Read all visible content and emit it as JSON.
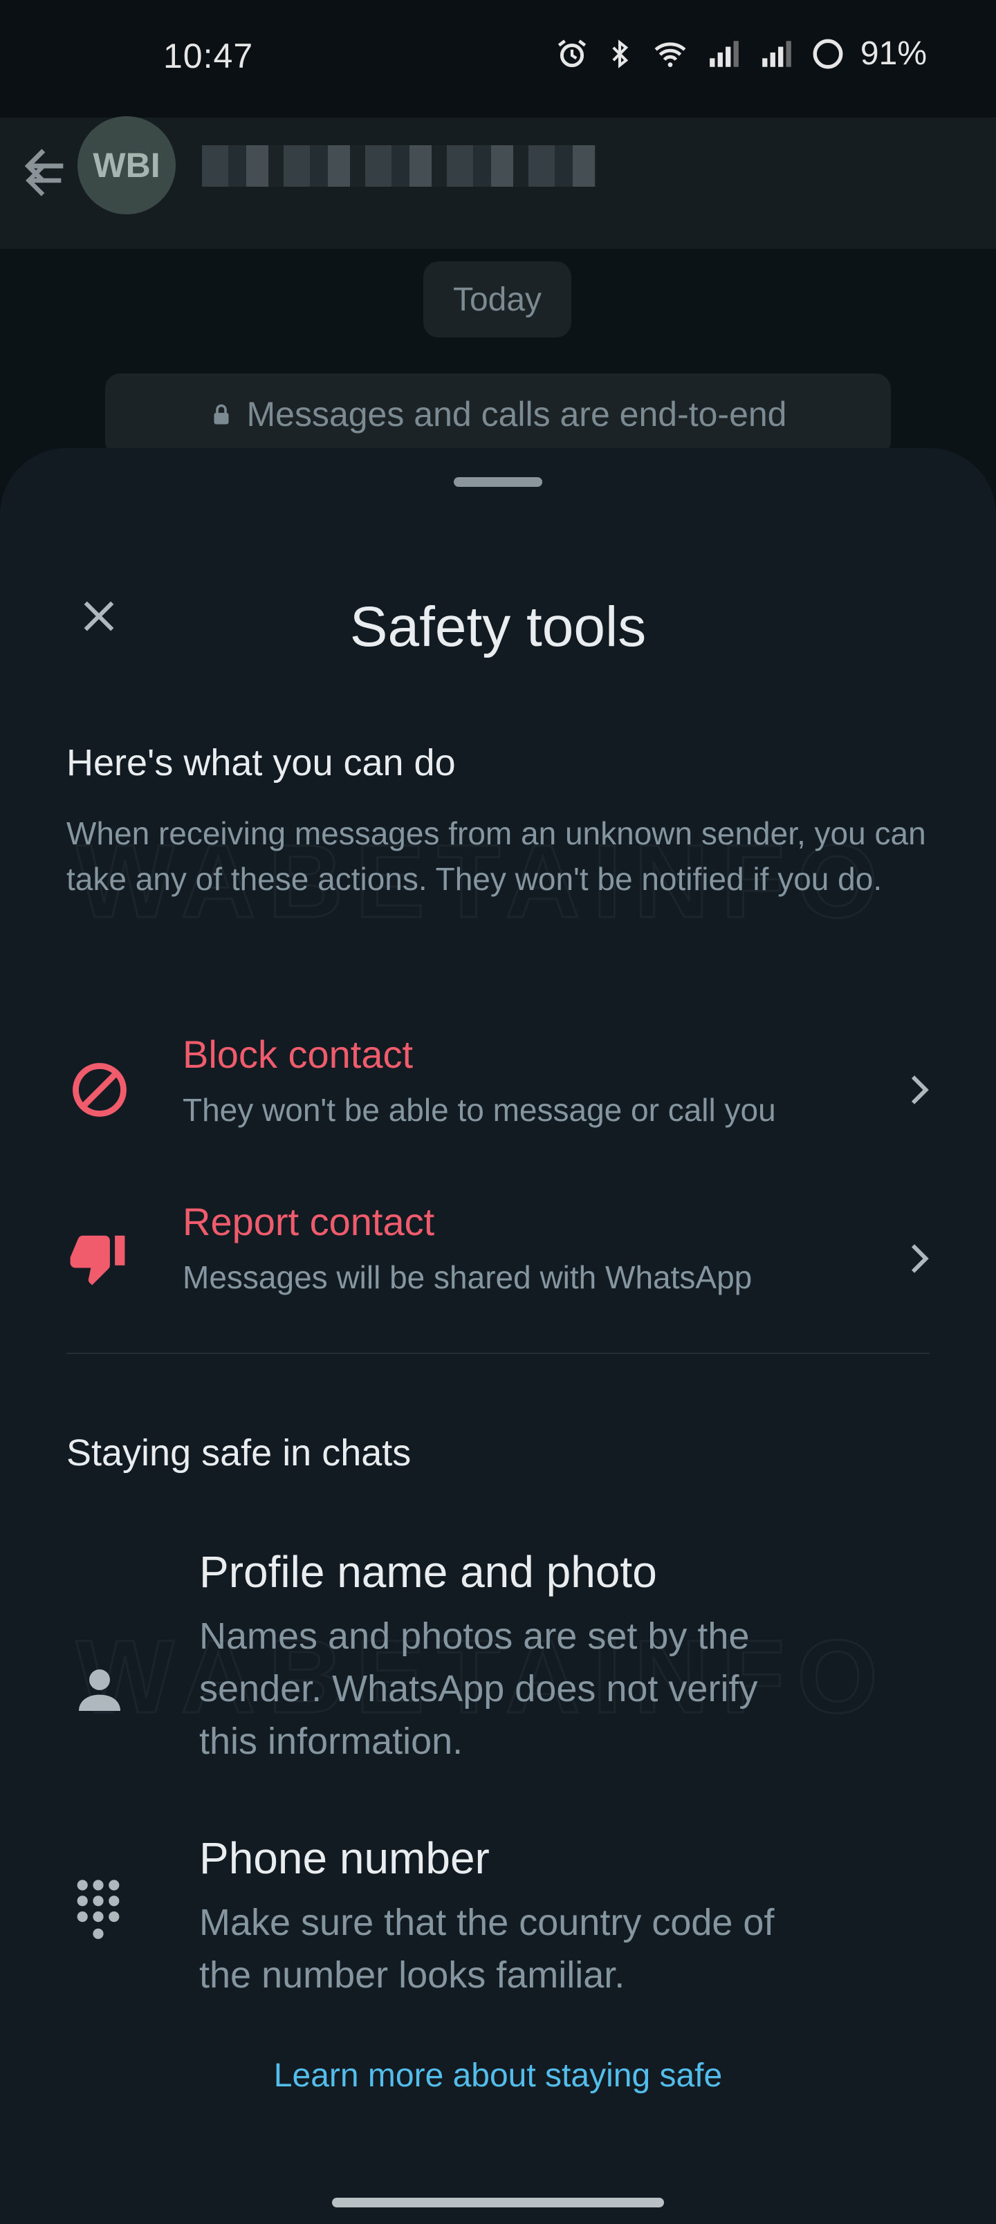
{
  "status_bar": {
    "time": "10:47",
    "battery": "91%"
  },
  "chat": {
    "avatar_text": "WBI",
    "date_chip": "Today",
    "encryption_notice": "Messages and calls are end-to-end"
  },
  "sheet": {
    "title": "Safety tools",
    "section1": {
      "heading": "Here's what you can do",
      "description": "When receiving messages from an unknown sender, you can take any of these actions. They won't be notified if you do."
    },
    "actions": [
      {
        "title": "Block contact",
        "subtitle": "They won't be able to message or call you",
        "icon": "block-icon"
      },
      {
        "title": "Report contact",
        "subtitle": "Messages will be shared with WhatsApp",
        "icon": "thumbs-down-icon"
      }
    ],
    "section2": {
      "heading": "Staying safe in chats"
    },
    "tips": [
      {
        "title": "Profile name and photo",
        "body": "Names and photos are set by the sender. WhatsApp does not verify this information.",
        "icon": "person-icon"
      },
      {
        "title": "Phone number",
        "body": "Make sure that the country code of the number looks familiar.",
        "icon": "dialpad-icon"
      }
    ],
    "learn_more": "Learn more about staying safe"
  },
  "colors": {
    "sheet_bg": "#121b22",
    "danger": "#f15c6d",
    "link": "#53bdeb",
    "muted": "#8696a0"
  }
}
